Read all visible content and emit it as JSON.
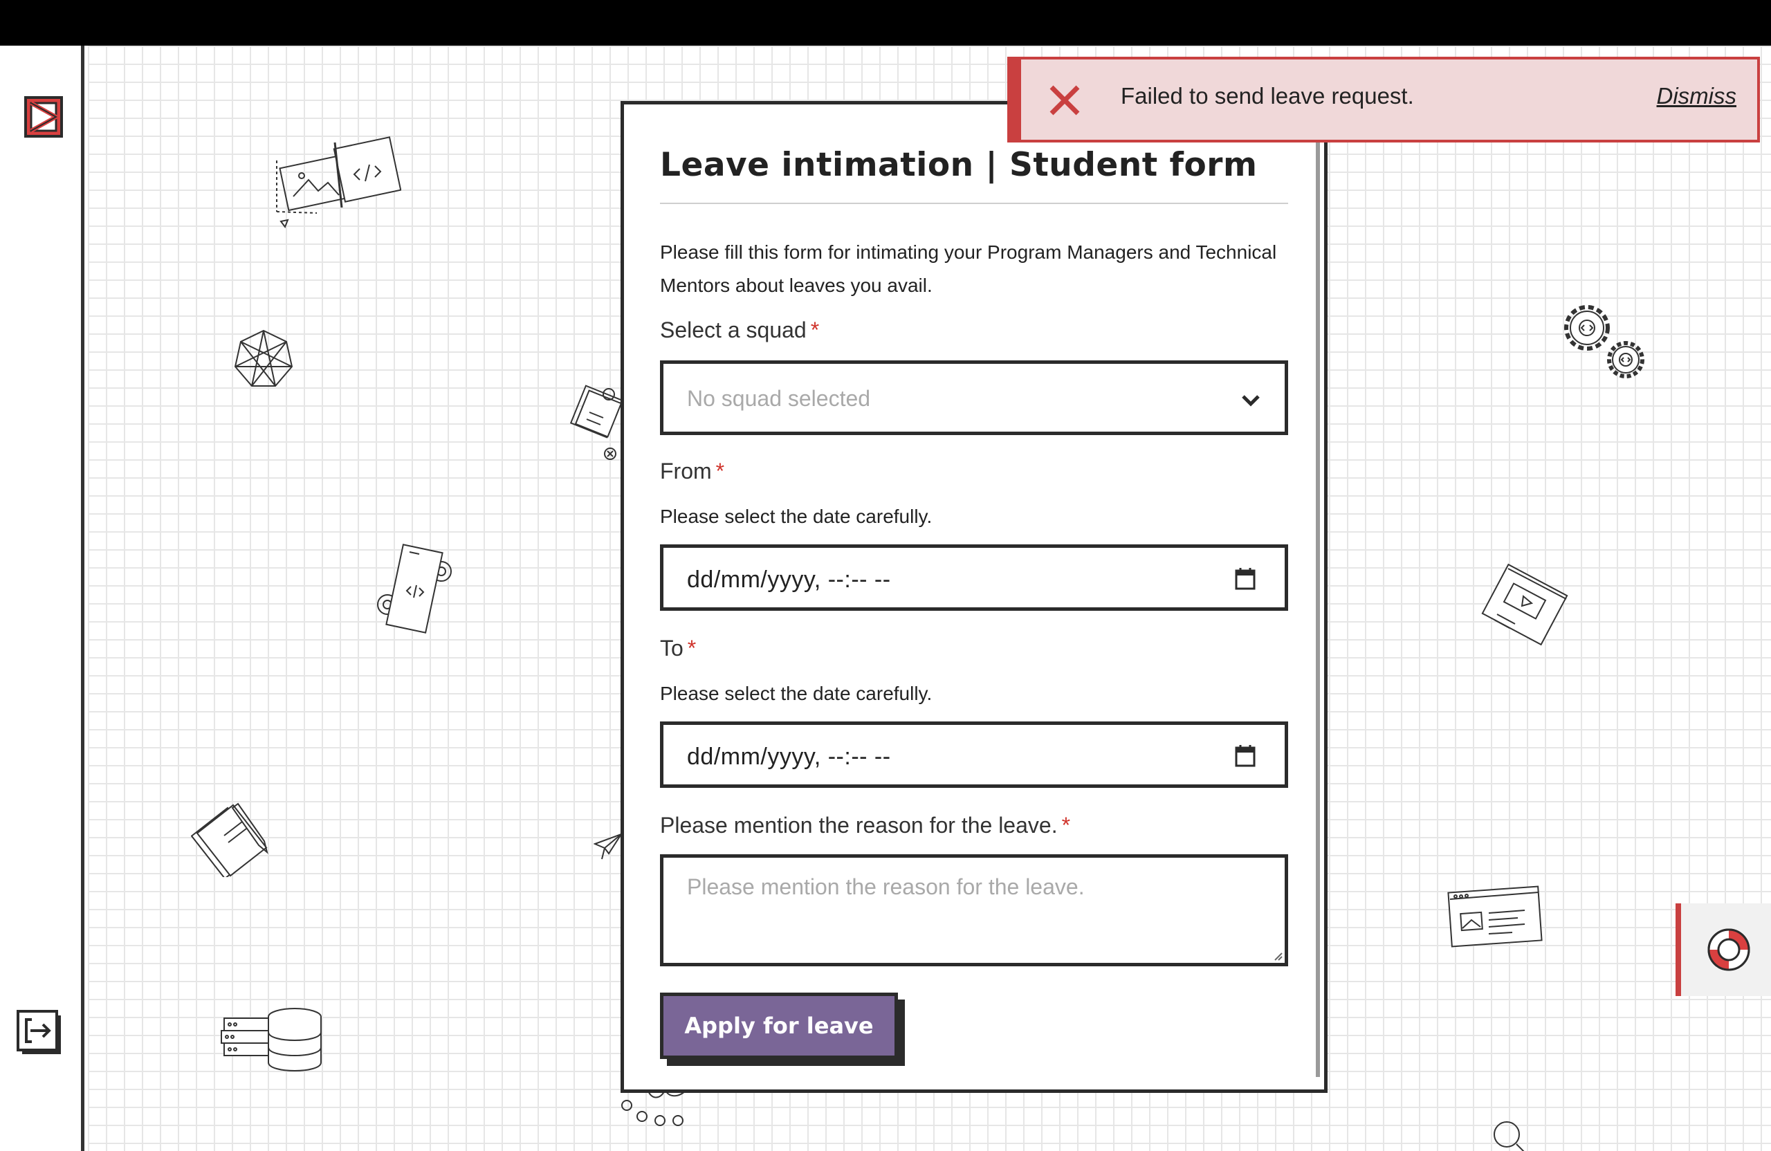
{
  "icons": {
    "logo": "brand-logo",
    "logout": "logout-icon",
    "help": "lifebuoy-icon",
    "error": "close-icon",
    "dropdown": "chevron-down-icon",
    "calendar": "calendar-icon"
  },
  "colors": {
    "accent": "#7a6697",
    "error": "#c94040",
    "error_bg": "#f0d8d9",
    "required": "#d0342c",
    "border": "#2b2b2b"
  },
  "toast": {
    "message": "Failed to send leave request.",
    "dismiss_label": "Dismiss"
  },
  "form": {
    "title": "Leave intimation | Student form",
    "intro": "Please fill this form for intimating your Program Managers and Technical Mentors about leaves you avail.",
    "required_mark": "*",
    "squad": {
      "label": "Select a squad",
      "value": "No squad selected"
    },
    "from": {
      "label": "From",
      "hint": "Please select the date carefully.",
      "value": "dd/mm/yyyy, --:-- --"
    },
    "to": {
      "label": "To",
      "hint": "Please select the date carefully.",
      "value": "dd/mm/yyyy, --:-- --"
    },
    "reason": {
      "label": "Please mention the reason for the leave.",
      "placeholder": "Please mention the reason for the leave."
    },
    "submit_label": "Apply for leave"
  }
}
